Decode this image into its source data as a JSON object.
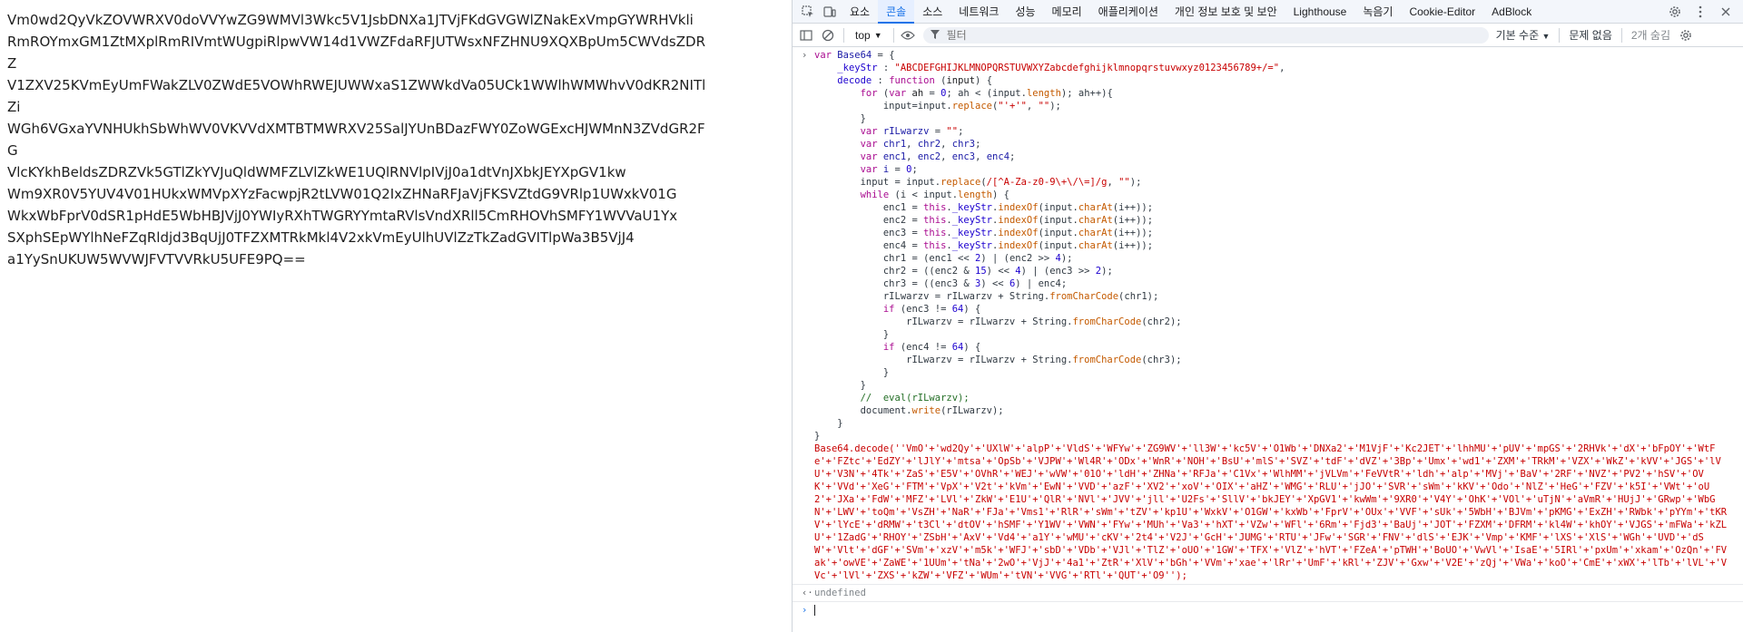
{
  "page": {
    "text_lines": [
      "Vm0wd2QyVkZOVWRXV0doVVYwZG9WMVl3Wkc5V1JsbDNXa1JTVjFKdGVGWlZNakExVmpGYWRHVkli",
      "RmROYmxGM1ZtMXplRmRIVmtWUgpiRlpwVW14d1VWZFdaRFJUTWsxNFZHNU9XQXBpUm5CWVdsZDRZ",
      "V1ZXV25KVmEyUmFWakZLV0ZWdE5VOWhRWEJUWWxaS1ZWWkdVa05UCk1WWlhWMWhvV0dKR2NITlZi",
      "WGh6VGxaYVNHUkhSbWhWV0VKVVdXMTBTMWRXV25SalJYUnBDazFWY0ZoWGExcHJWMnN3ZVdGR2FG",
      "VlcKYkhBeldsZDRZVk5GTlZkYVJuQldWMFZLVlZkWE1UQlRNVlpIVjJ0a1dtVnJXbkJEYXpGV1kw",
      "Wm9XR0V5YUV4V01HUkxWMVpXYzFacwpjR2tLVW01Q2IxZHNaRFJaVjFKSVZtdG9VRlp1UWxkV01G",
      "WkxWbFprV0dSR1pHdE5WbHBJVjJ0YWIyRXhTWGRYYmtaRVlsVndXRll5CmRHOVhSMFY1WVVaU1Yx",
      "SXphSEpWYlhNeFZqRldjd3BqUjJ0TFZXMTRkMkl4V2xkVmEyUlhUVlZzTkZadGVITlpWa3B5VjJ4",
      "a1YySnUKUW5WVWJFVTVVRkU5UFE9PQ=="
    ]
  },
  "devtools": {
    "tabs": [
      "요소",
      "콘솔",
      "소스",
      "네트워크",
      "성능",
      "메모리",
      "애플리케이션",
      "개인 정보 보호 및 보안",
      "Lighthouse",
      "녹음기",
      "Cookie-Editor",
      "AdBlock"
    ],
    "active_tab": "콘솔",
    "toolbar": {
      "context": "top",
      "filter_placeholder": "필터",
      "level": "기본 수준",
      "issues": "문제 없음",
      "hidden": "2개 숨김"
    },
    "console": {
      "base64_decode_call": "Base64.decode(''VmO'+'wd2Qy'+'UXlW'+'alpP'+'VldS'+'WFYw'+'ZG9WV'+'ll3W'+'kc5V'+'O1Wb'+'DNXa2'+'M1VjF'+'Kc2JET'+'lhhMU'+'pUV'+'mpGS'+'2RHVk'+'dX'+'bFpOY'+'WtFe'+'FZtc'+'EdZY'+'lJlY'+'mtsa'+'OpSb'+'VJPW'+'Wl4R'+'ODx'+'WnR'+'NOH'+'BsU'+'mlS'+'SVZ'+'tdF'+'dVZ'+'3Bp'+'Umx'+'wd1'+'ZXM'+'TRkM'+'VZX'+'WkZ'+'kVV'+'JGS'+'lVU'+'V3N'+'4Tk'+'ZaS'+'E5V'+'OVhR'+'WEJ'+'wVW'+'01O'+'ldH'+'ZHNa'+'RFJa'+'C1Vx'+'WlhMM'+'jVLVm'+'FeVVtR'+'ldh'+'alp'+'MVj'+'BaV'+'2RF'+'NVZ'+'PV2'+'hSV'+'OVK'+'VVd'+'XeG'+'FTM'+'VpX'+'V2t'+'kVm'+'EwN'+'VVD'+'azF'+'XV2'+'xoV'+'OIX'+'aHZ'+'WMG'+'RLU'+'jJO'+'SVR'+'sWm'+'kKV'+'Odo'+'NlZ'+'HeG'+'FZV'+'k5I'+'VWt'+'oU2'+'JXa'+'FdW'+'MFZ'+'LVl'+'ZkW'+'E1U'+'QlR'+'NVl'+'JVV'+'jll'+'U2Fs'+'SllV'+'bkJEY'+'XpGV1'+'kwWm'+'9XR0'+'V4Y'+'OhK'+'VOl'+'uTjN'+'aVmR'+'HUjJ'+'GRwp'+'WbGN'+'LWV'+'toQm'+'VsZH'+'NaR'+'FJa'+'Vms1'+'RlR'+'sWm'+'tZV'+'kp1U'+'WxkV'+'O1GW'+'kxWb'+'FprV'+'OUx'+'VVF'+'sUk'+'5WbH'+'BJVm'+'pKMG'+'ExZH'+'RWbk'+'pYYm'+'tKRV'+'lYcE'+'dRMW'+'t3Cl'+'dtOV'+'hSMF'+'Y1WV'+'VWN'+'FYw'+'MUh'+'Va3'+'hXT'+'VZw'+'WFl'+'6Rm'+'Fjd3'+'BaUj'+'JOT'+'FZXM'+'DFRM'+'kl4W'+'khOY'+'VJGS'+'mFWa'+'kZLU'+'1ZadG'+'RHOY'+'ZSbH'+'AxV'+'Vd4'+'a1Y'+'wMU'+'cKV'+'2t4'+'V2J'+'GcH'+'JUMG'+'RTU'+'JFw'+'SGR'+'FNV'+'dlS'+'EJK'+'Vmp'+'KMF'+'lXS'+'XlS'+'WGh'+'UVD'+'dSW'+'Vlt'+'dGF'+'SVm'+'xzV'+'m5k'+'WFJ'+'sbD'+'VDb'+'VJl'+'TlZ'+'oUO'+'1GW'+'TFX'+'VlZ'+'hVT'+'FZeA'+'pTWH'+'BoUO'+'VwVl'+'IsaE'+'5IRl'+'pxUm'+'xkam'+'OzQn'+'FVak'+'owVE'+'ZaWE'+'1UUm'+'tNa'+'2wO'+'VjJ'+'4a1'+'ZtR'+'XlV'+'bGh'+'VVm'+'xae'+'lRr'+'UmF'+'kRl'+'ZJV'+'Gxw'+'V2E'+'zQj'+'VWa'+'koO'+'CmE'+'xWX'+'lTb'+'lVL'+'VVc'+'lVl'+'ZXS'+'kZW'+'VFZ'+'WUm'+'tVN'+'VVG'+'RTl'+'QUT'+'O9'');",
      "undefined_label": "undefined"
    }
  }
}
